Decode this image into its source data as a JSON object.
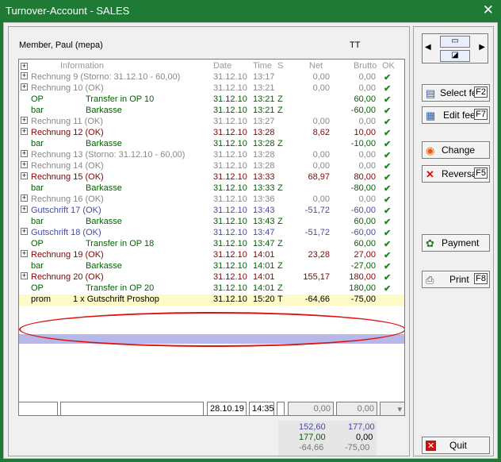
{
  "window": {
    "title": "Turnover-Account - SALES",
    "close": "✕"
  },
  "member": "Member, Paul (mepa)",
  "tt": "TT",
  "headers": {
    "information": "Information",
    "date": "Date",
    "time": "Time",
    "s": "S",
    "net": "Net",
    "brutto": "Brutto",
    "ok": "OK"
  },
  "rows": [
    {
      "kind": "main",
      "color": "grey",
      "info": "Rechnung 9 (Storno: 31.12.10 - 60,00)",
      "date": "31.12.10",
      "time": "13:17",
      "s": "",
      "net": "0,00",
      "brutto": "0,00"
    },
    {
      "kind": "main",
      "color": "grey",
      "info": "Rechnung 10 (OK)",
      "date": "31.12.10",
      "time": "13:21",
      "s": "",
      "net": "0,00",
      "brutto": "0,00"
    },
    {
      "kind": "sub",
      "color": "green",
      "a": "OP",
      "b": "Transfer in OP 10",
      "date": "31.12.10",
      "time": "13:21",
      "s": "Z",
      "net": "",
      "brutto": "60,00"
    },
    {
      "kind": "sub",
      "color": "green",
      "a": "bar",
      "b": "Barkasse",
      "date": "31.12.10",
      "time": "13:21",
      "s": "Z",
      "net": "",
      "brutto": "-60,00"
    },
    {
      "kind": "main",
      "color": "grey",
      "info": "Rechnung 11 (OK)",
      "date": "31.12.10",
      "time": "13:27",
      "s": "",
      "net": "0,00",
      "brutto": "0,00"
    },
    {
      "kind": "main",
      "color": "red",
      "info": "Rechnung 12 (OK)",
      "date": "31.12.10",
      "time": "13:28",
      "s": "",
      "net": "8,62",
      "brutto": "10,00"
    },
    {
      "kind": "sub",
      "color": "green",
      "a": "bar",
      "b": "Barkasse",
      "date": "31.12.10",
      "time": "13:28",
      "s": "Z",
      "net": "",
      "brutto": "-10,00"
    },
    {
      "kind": "main",
      "color": "grey",
      "info": "Rechnung 13 (Storno: 31.12.10 - 60,00)",
      "date": "31.12.10",
      "time": "13:28",
      "s": "",
      "net": "0,00",
      "brutto": "0,00"
    },
    {
      "kind": "main",
      "color": "grey",
      "info": "Rechnung 14 (OK)",
      "date": "31.12.10",
      "time": "13:28",
      "s": "",
      "net": "0,00",
      "brutto": "0,00"
    },
    {
      "kind": "main",
      "color": "red",
      "info": "Rechnung 15 (OK)",
      "date": "31.12.10",
      "time": "13:33",
      "s": "",
      "net": "68,97",
      "brutto": "80,00"
    },
    {
      "kind": "sub",
      "color": "green",
      "a": "bar",
      "b": "Barkasse",
      "date": "31.12.10",
      "time": "13:33",
      "s": "Z",
      "net": "",
      "brutto": "-80,00"
    },
    {
      "kind": "main",
      "color": "grey",
      "info": "Rechnung 16 (OK)",
      "date": "31.12.10",
      "time": "13:36",
      "s": "",
      "net": "0,00",
      "brutto": "0,00"
    },
    {
      "kind": "main",
      "color": "blue",
      "info": "Gutschrift 17 (OK)",
      "date": "31.12.10",
      "time": "13:43",
      "s": "",
      "net": "-51,72",
      "brutto": "-60,00"
    },
    {
      "kind": "sub",
      "color": "green",
      "a": "bar",
      "b": "Barkasse",
      "date": "31.12.10",
      "time": "13:43",
      "s": "Z",
      "net": "",
      "brutto": "60,00"
    },
    {
      "kind": "main",
      "color": "blue",
      "info": "Gutschrift 18 (OK)",
      "date": "31.12.10",
      "time": "13:47",
      "s": "",
      "net": "-51,72",
      "brutto": "-60,00"
    },
    {
      "kind": "sub",
      "color": "green",
      "a": "OP",
      "b": "Transfer in OP 18",
      "date": "31.12.10",
      "time": "13:47",
      "s": "Z",
      "net": "",
      "brutto": "60,00"
    },
    {
      "kind": "main",
      "color": "red",
      "info": "Rechnung 19 (OK)",
      "date": "31.12.10",
      "time": "14:01",
      "s": "",
      "net": "23,28",
      "brutto": "27,00"
    },
    {
      "kind": "sub",
      "color": "green",
      "a": "bar",
      "b": "Barkasse",
      "date": "31.12.10",
      "time": "14:01",
      "s": "Z",
      "net": "",
      "brutto": "-27,00"
    },
    {
      "kind": "main",
      "color": "red",
      "info": "Rechnung 20 (OK)",
      "date": "31.12.10",
      "time": "14:01",
      "s": "",
      "net": "155,17",
      "brutto": "180,00"
    },
    {
      "kind": "sub",
      "color": "green",
      "a": "OP",
      "b": "Transfer in OP 20",
      "date": "31.12.10",
      "time": "14:01",
      "s": "Z",
      "net": "",
      "brutto": "180,00"
    },
    {
      "kind": "sel",
      "color": "black",
      "a": "prom",
      "b": "1 x Gutschrift Proshop",
      "date": "31.12.10",
      "time": "15:20",
      "s": "T",
      "net": "-64,66",
      "brutto": "-75,00"
    }
  ],
  "inputs": {
    "date": "28.10.19",
    "time": "14:35",
    "net": "0,00",
    "brutto": "0,00"
  },
  "totals": {
    "r1_net": "152,60",
    "r1_brutto": "177,00",
    "r2_net": "177,00",
    "r2_brutto": "0,00",
    "r3_net": "-64,66",
    "r3_brutto": "-75,00"
  },
  "buttons": {
    "select_fee": "Select fee",
    "select_fee_key": "F2",
    "edit_fee": "Edit fee",
    "edit_fee_key": "F7",
    "change": "Change",
    "reversal": "Reversal",
    "reversal_key": "F5",
    "payment": "Payment",
    "print": "Print",
    "print_key": "F8",
    "quit": "Quit"
  },
  "colors": {
    "titlebar": "#1f7a35",
    "grey": "#888888",
    "red": "#8b0000",
    "green": "#006400",
    "blue": "#4a4aa8",
    "highlight": "#e01010"
  }
}
